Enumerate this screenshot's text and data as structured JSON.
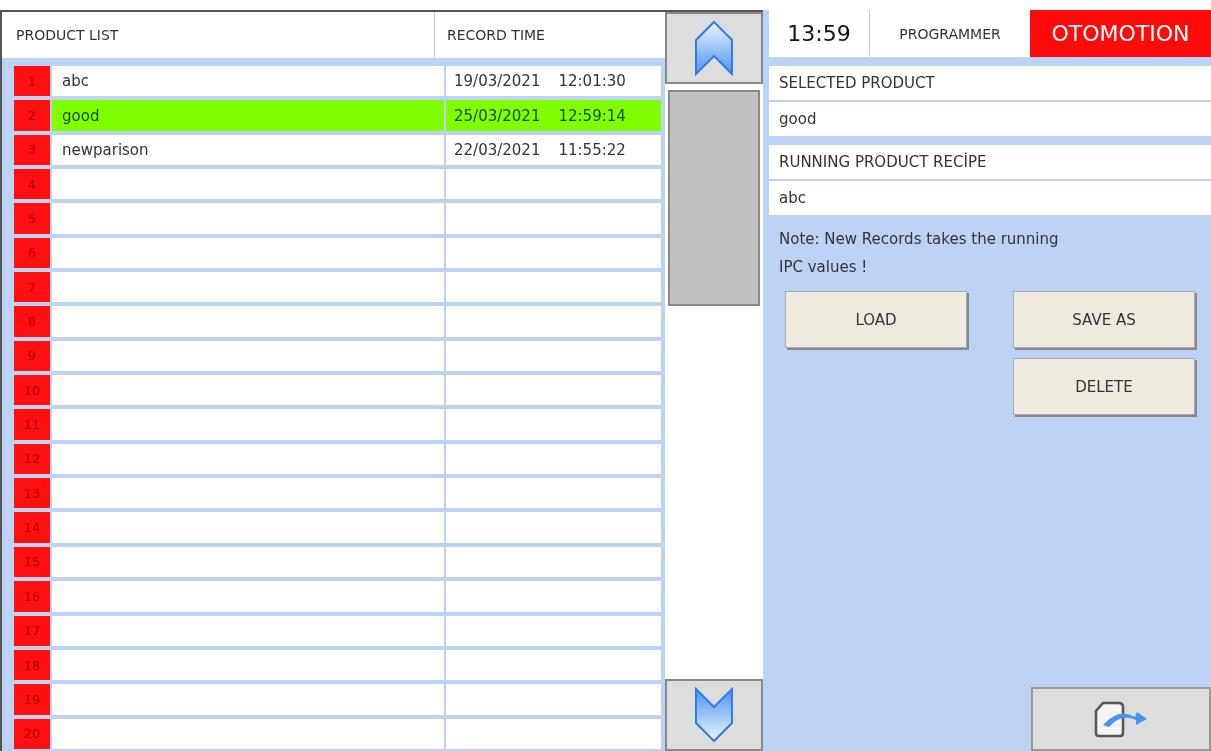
{
  "table": {
    "columns": [
      "PRODUCT LIST",
      "RECORD TIME"
    ],
    "rows": [
      {
        "number": "1",
        "name": "abc",
        "date": "19/03/2021",
        "time": "12:01:30",
        "selected": false
      },
      {
        "number": "2",
        "name": "good",
        "date": "25/03/2021",
        "time": "12:59:14",
        "selected": true
      },
      {
        "number": "3",
        "name": "newparison",
        "date": "22/03/2021",
        "time": "11:55:22",
        "selected": false
      },
      {
        "number": "4",
        "selected": false
      },
      {
        "number": "5",
        "selected": false
      },
      {
        "number": "6",
        "selected": false
      },
      {
        "number": "7",
        "selected": false
      },
      {
        "number": "8",
        "selected": false
      },
      {
        "number": "9",
        "selected": false
      },
      {
        "number": "10",
        "selected": false
      },
      {
        "number": "11",
        "selected": false
      },
      {
        "number": "12",
        "selected": false
      },
      {
        "number": "13",
        "selected": false
      },
      {
        "number": "14",
        "selected": false
      },
      {
        "number": "15",
        "selected": false
      },
      {
        "number": "16",
        "selected": false
      },
      {
        "number": "17",
        "selected": false
      },
      {
        "number": "18",
        "selected": false
      },
      {
        "number": "19",
        "selected": false
      },
      {
        "number": "20",
        "selected": false
      }
    ]
  },
  "header": {
    "clock": "13:59",
    "user": "PROGRAMMER",
    "mode": "OTOMOTION"
  },
  "selected_product": {
    "label": "SELECTED PRODUCT",
    "value": "good"
  },
  "running_recipe": {
    "label": "RUNNING PRODUCT RECİPE",
    "value": "abc"
  },
  "note": [
    "Note: New Records takes the running",
    "IPC values !"
  ],
  "buttons": {
    "load": "LOAD",
    "save_as": "SAVE AS",
    "delete": "DELETE"
  }
}
